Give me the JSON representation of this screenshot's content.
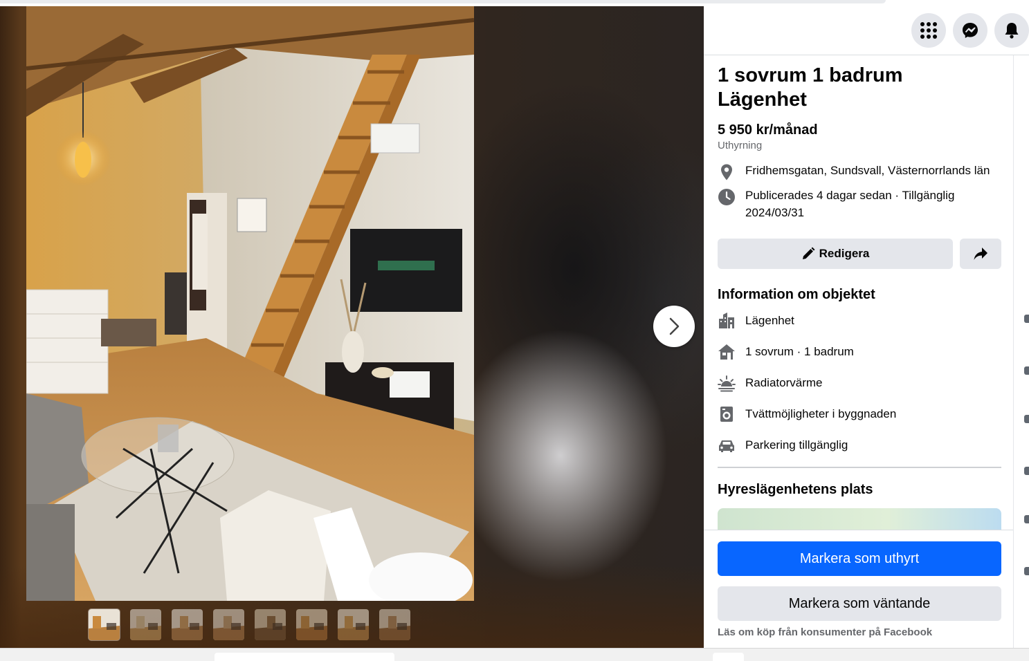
{
  "colors": {
    "primary_button": "#0866ff",
    "secondary_button": "#e4e6eb",
    "text_primary": "#050505",
    "text_secondary": "#65676b"
  },
  "header": {
    "icons": [
      "menu-grid-icon",
      "messenger-icon",
      "notifications-bell-icon"
    ]
  },
  "viewer": {
    "next_icon": "chevron-right-icon",
    "thumbnail_count": 8,
    "active_thumbnail": 1
  },
  "listing": {
    "title": "1 sovrum 1 badrum Lägenhet",
    "price": "5 950 kr/månad",
    "type": "Uthyrning",
    "location": "Fridhemsgatan, Sundsvall, Västernorrlands län",
    "published": "Publicerades 4 dagar sedan · Tillgänglig 2024/03/31"
  },
  "actions": {
    "edit_label": "Redigera",
    "share_icon": "share-arrow-icon"
  },
  "info": {
    "heading": "Information om objektet",
    "attributes": [
      {
        "icon": "building-icon",
        "label": "Lägenhet"
      },
      {
        "icon": "house-icon",
        "label": "1 sovrum · 1 badrum"
      },
      {
        "icon": "heating-icon",
        "label": "Radiatorvärme"
      },
      {
        "icon": "washer-icon",
        "label": "Tvättmöjligheter i byggnaden"
      },
      {
        "icon": "car-icon",
        "label": "Parkering tillgänglig"
      }
    ]
  },
  "place": {
    "heading": "Hyreslägenhetens plats"
  },
  "footer": {
    "mark_rented": "Markera som uthyrt",
    "mark_pending": "Markera som väntande",
    "consumer_link": "Läs om köp från konsumenter på Facebook"
  }
}
